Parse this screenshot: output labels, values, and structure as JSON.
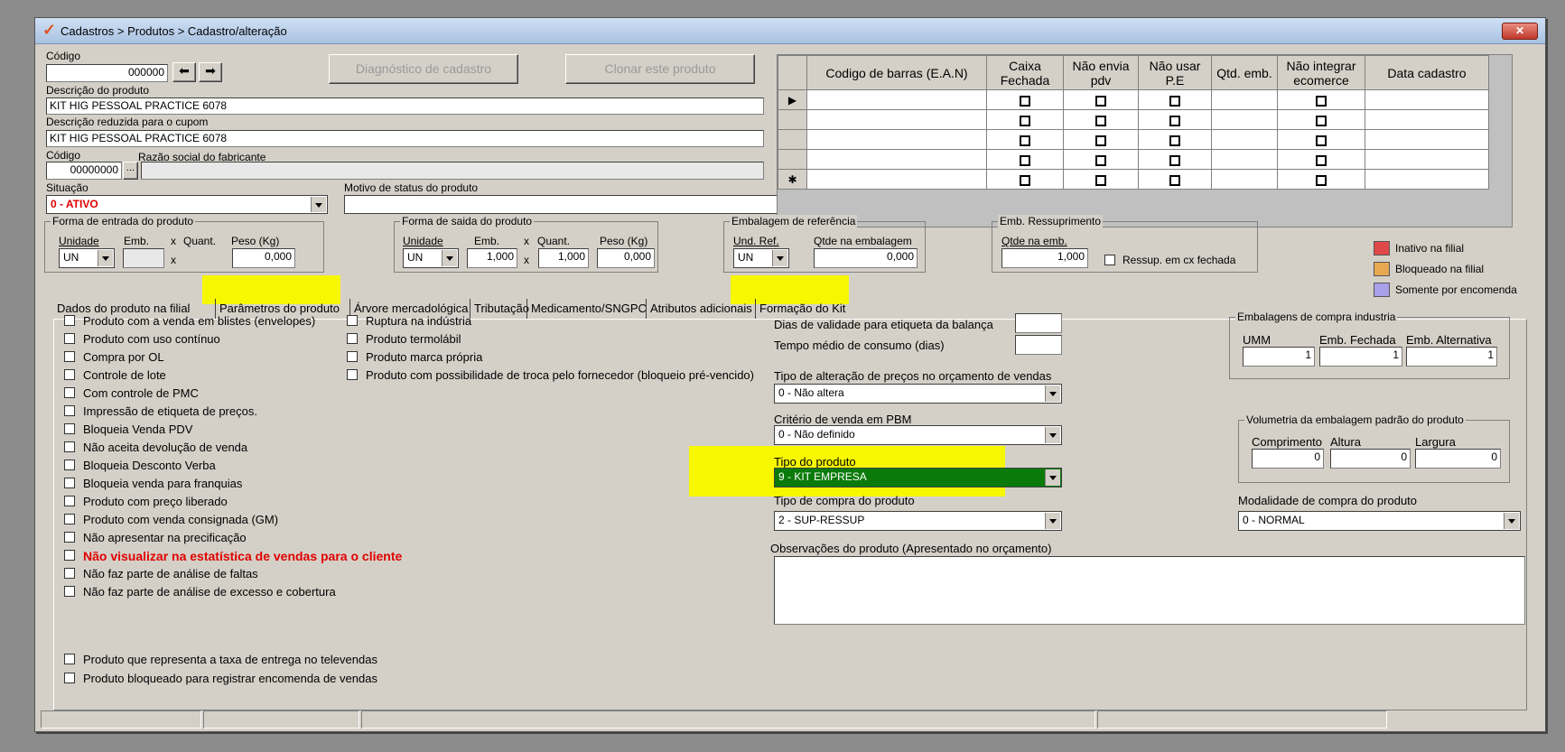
{
  "window": {
    "title": "Cadastros > Produtos > Cadastro/alteração",
    "close": "✕"
  },
  "header": {
    "codigo_label": "Código",
    "codigo_value": "000000",
    "diag_btn": "Diagnóstico de cadastro",
    "clone_btn": "Clonar este produto",
    "descricao_label": "Descrição  do produto",
    "descricao_value": "KIT HIG PESSOAL PRACTICE 6078",
    "desc_red_label": "Descrição reduzida para o cupom",
    "desc_red_value": "KIT HIG PESSOAL PRACTICE 6078",
    "fab_codigo_label": "Código",
    "fab_codigo_value": "00000000",
    "fab_dots": "...",
    "razao_label": "Razão social do fabricante",
    "situacao_label": "Situação",
    "situacao_value": "0 - ATIVO",
    "motivo_label": "Motivo de status do produto",
    "motivo_value": ""
  },
  "entrada": {
    "title": "Forma de entrada do produto",
    "unidade_label": "Unidade",
    "emb_label": "Emb.",
    "x1": "x",
    "quant_label": "Quant.",
    "peso_label": "Peso (Kg)",
    "unidade_value": "UN",
    "emb_value": "",
    "x2": "x",
    "peso_value": "0,000"
  },
  "saida": {
    "title": "Forma de saida do produto",
    "unidade_label": "Unidade",
    "emb_label": "Emb.",
    "x1": "x",
    "quant_label": "Quant.",
    "peso_label": "Peso (Kg)",
    "unidade_value": "UN",
    "emb_value": "1,000",
    "x2": "x",
    "quant_value": "1,000",
    "peso_value": "0,000"
  },
  "embref": {
    "title": "Embalagem de referência",
    "und_label": "Und. Ref.",
    "qtde_label": "Qtde na embalagem",
    "und_value": "UN",
    "qtde_value": "0,000"
  },
  "ressup": {
    "title": "Emb. Ressuprimento",
    "qtde_label": "Qtde na emb.",
    "qtde_value": "1,000",
    "cx_label": "Ressup. em cx fechada"
  },
  "legend": {
    "items": [
      {
        "label": "Inativo na filial",
        "color": "#e04848"
      },
      {
        "label": "Bloqueado na filial",
        "color": "#e8a850"
      },
      {
        "label": "Somente por encomenda",
        "color": "#a8a0e8"
      }
    ]
  },
  "grid": {
    "columns": [
      "Codigo de barras (E.A.N)",
      "Caixa Fechada",
      "Não envia pdv",
      "Não usar P.E",
      "Qtd. emb.",
      "Não integrar ecomerce",
      "Data cadastro"
    ],
    "row_markers": [
      "▶",
      "",
      "",
      "",
      "✱"
    ]
  },
  "tabs": [
    "Dados do produto na filial",
    "Parâmetros do produto",
    "Árvore mercadológica",
    "Tributação",
    "Medicamento/SNGPC",
    "Atributos adicionais",
    "Formação do Kit"
  ],
  "checks_left": [
    "Produto com a venda em blistes (envelopes)",
    "Produto com uso contínuo",
    "Compra por OL",
    "Controle de lote",
    "Com controle de PMC",
    "Impressão de etiqueta de preços.",
    "Bloqueia Venda PDV",
    "Não aceita devolução de venda",
    "Bloqueia Desconto Verba",
    "Bloqueia venda para franquias",
    "Produto com preço liberado",
    "Produto com venda consignada (GM)",
    "Não apresentar na precificação",
    "Não visualizar na estatística de vendas para o cliente",
    "Não faz parte de análise de faltas",
    "Não faz parte de análise de excesso e cobertura"
  ],
  "checks_left_bottom": [
    "Produto que representa a taxa de entrega no televendas",
    "Produto bloqueado para registrar encomenda de vendas"
  ],
  "checks_mid": [
    "Ruptura na indústria",
    "Produto termolábil",
    "Produto marca própria",
    "Produto com possibilidade de troca pelo fornecedor (bloqueio pré-vencido)"
  ],
  "form": {
    "dias_validade_label": "Dias de validade para etiqueta da balança",
    "tempo_medio_label": "Tempo médio de consumo (dias)",
    "tipo_alteracao_label": "Tipo de alteração de preços no orçamento de vendas",
    "tipo_alteracao_value": "0 - Não altera",
    "criterio_label": "Critério de venda em PBM",
    "criterio_value": "0 - Não definido",
    "tipo_produto_label": "Tipo do produto",
    "tipo_produto_value": "9 - KIT EMPRESA",
    "tipo_compra_label": "Tipo de compra do produto",
    "tipo_compra_value": "2 - SUP-RESSUP",
    "obs_label": "Observações do produto (Apresentado no orçamento)",
    "modalidade_label": "Modalidade de compra do produto",
    "modalidade_value": "0 - NORMAL"
  },
  "emb_compra": {
    "title": "Embalagens de compra industria",
    "umm_label": "UMM",
    "fechada_label": "Emb. Fechada",
    "alt_label": "Emb. Alternativa",
    "umm": "1",
    "fechada": "1",
    "alt": "1"
  },
  "volumetria": {
    "title": "Volumetria da embalagem padrão do produto",
    "comp_label": "Comprimento",
    "alt_label": "Altura",
    "larg_label": "Largura",
    "comp": "0",
    "alt": "0",
    "larg": "0"
  }
}
